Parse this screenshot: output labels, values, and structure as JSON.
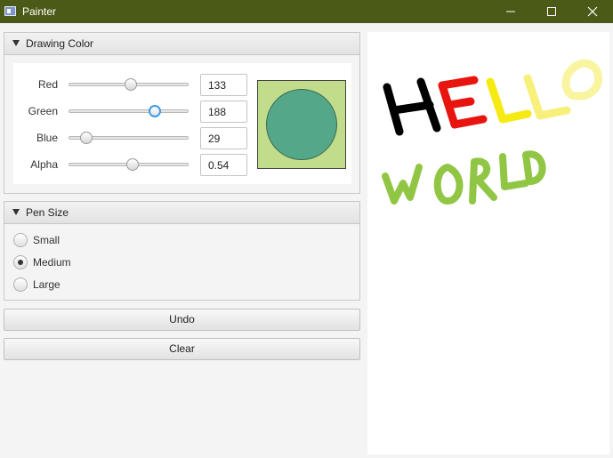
{
  "window": {
    "title": "Painter",
    "accent": "#4b5a16"
  },
  "drawing_color": {
    "title": "Drawing Color",
    "rows": [
      {
        "label": "Red",
        "value": "133",
        "fraction": 0.52
      },
      {
        "label": "Green",
        "value": "188",
        "fraction": 0.74
      },
      {
        "label": "Blue",
        "value": "29",
        "fraction": 0.11
      },
      {
        "label": "Alpha",
        "value": "0.54",
        "fraction": 0.54
      }
    ],
    "preview_background": "#c1dd8c",
    "preview_circle": "#54a889"
  },
  "pen_size": {
    "title": "Pen Size",
    "options": [
      {
        "label": "Small",
        "selected": false
      },
      {
        "label": "Medium",
        "selected": true
      },
      {
        "label": "Large",
        "selected": false
      }
    ]
  },
  "buttons": {
    "undo": "Undo",
    "clear": "Clear"
  },
  "canvas": {
    "strokes": [
      {
        "word": "HELLO",
        "letters": [
          {
            "letter": "H",
            "color": "#000000"
          },
          {
            "letter": "E",
            "color": "#e8140f"
          },
          {
            "letter": "L",
            "color": "#f5ea12"
          },
          {
            "letter": "L",
            "color": "#f7f07a"
          },
          {
            "letter": "O",
            "color": "#f9f4a0"
          }
        ]
      },
      {
        "word": "WORLD",
        "color": "#8cc43c"
      }
    ]
  }
}
